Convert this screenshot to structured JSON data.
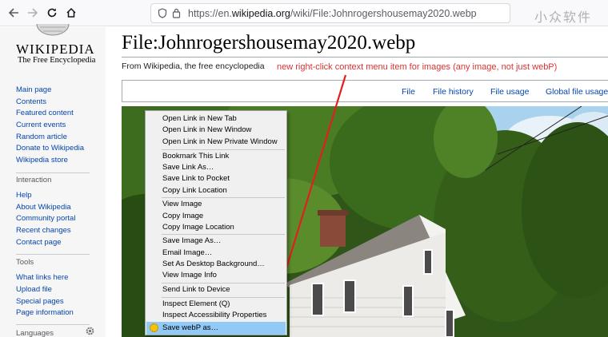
{
  "browser": {
    "url_prefix": "https://en.",
    "url_domain": "wikipedia.org",
    "url_path": "/wiki/File:Johnrogershousemay2020.webp",
    "icons": [
      "back-icon",
      "forward-icon",
      "reload-icon",
      "home-icon",
      "shield-icon",
      "page-info-icon"
    ]
  },
  "watermark": "小众软件",
  "sidebar": {
    "logo_word": "WIKIPEDIA",
    "logo_tagline": "The Free Encyclopedia",
    "main": [
      "Main page",
      "Contents",
      "Featured content",
      "Current events",
      "Random article",
      "Donate to Wikipedia",
      "Wikipedia store"
    ],
    "interaction_heading": "Interaction",
    "interaction": [
      "Help",
      "About Wikipedia",
      "Community portal",
      "Recent changes",
      "Contact page"
    ],
    "tools_heading": "Tools",
    "tools": [
      "What links here",
      "Upload file",
      "Special pages",
      "Page information"
    ],
    "languages_heading": "Languages"
  },
  "page": {
    "title": "File:Johnrogershousemay2020.webp",
    "tagline": "From Wikipedia, the free encyclopedia",
    "annotation": "new right-click context menu item for images (any image, not just webP)",
    "tabs": [
      "File",
      "File history",
      "File usage",
      "Global file usage"
    ]
  },
  "context_menu": {
    "groups": [
      [
        "Open Link in New Tab",
        "Open Link in New Window",
        "Open Link in New Private Window"
      ],
      [
        "Bookmark This Link",
        "Save Link As…",
        "Save Link to Pocket",
        "Copy Link Location"
      ],
      [
        "View Image",
        "Copy Image",
        "Copy Image Location"
      ],
      [
        "Save Image As…",
        "Email Image…",
        "Set As Desktop Background…",
        "View Image Info"
      ],
      [
        "Send Link to Device"
      ],
      [
        "Inspect Element (Q)",
        "Inspect Accessibility Properties"
      ],
      [
        "Save webP as…"
      ]
    ],
    "highlighted": "Save webP as…",
    "highlight_color": "#91c9f7"
  },
  "colors": {
    "link": "#0645ad",
    "annotation": "#e03030",
    "arrow": "#e02020"
  }
}
